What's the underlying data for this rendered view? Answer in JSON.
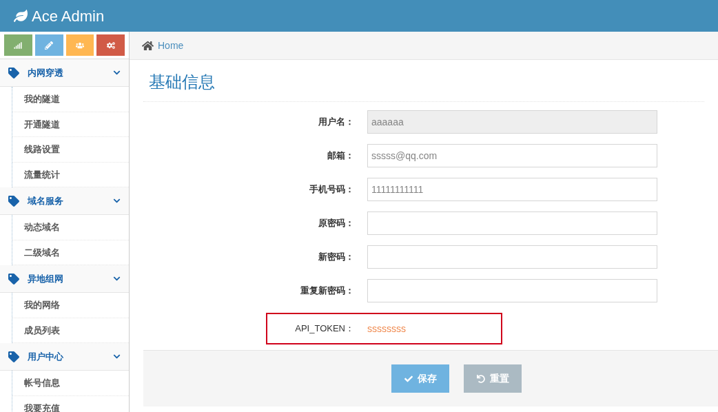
{
  "header": {
    "brand": "Ace Admin"
  },
  "shortcuts": [
    {
      "kind": "chart",
      "color": "#82af6f"
    },
    {
      "kind": "pencil",
      "color": "#6fb3e0"
    },
    {
      "kind": "users",
      "color": "#ffb752"
    },
    {
      "kind": "cogs",
      "color": "#d15b47"
    }
  ],
  "sidebar": {
    "groups": [
      {
        "label": "内网穿透",
        "expanded": true,
        "items": [
          "我的隧道",
          "开通隧道",
          "线路设置",
          "流量统计"
        ]
      },
      {
        "label": "域名服务",
        "expanded": true,
        "items": [
          "动态域名",
          "二级域名"
        ]
      },
      {
        "label": "异地组网",
        "expanded": true,
        "items": [
          "我的网络",
          "成员列表"
        ]
      },
      {
        "label": "用户中心",
        "expanded": true,
        "items": [
          "帐号信息",
          "我要充值"
        ]
      }
    ]
  },
  "breadcrumb": {
    "label": "Home"
  },
  "page_title": "基础信息",
  "form": {
    "fields": [
      {
        "label": "用户名：",
        "value": "aaaaaa",
        "disabled": true
      },
      {
        "label": "邮箱：",
        "value": "sssss@qq.com",
        "disabled": false
      },
      {
        "label": "手机号码：",
        "value": "11111111111",
        "disabled": false
      },
      {
        "label": "原密码：",
        "disabled": false
      },
      {
        "label": "新密码：",
        "disabled": false
      },
      {
        "label": "重复新密码：",
        "disabled": false
      }
    ],
    "token": {
      "label": "API_TOKEN：",
      "value": "ssssssss",
      "highlighted": true
    }
  },
  "buttons": [
    {
      "kind": "save",
      "label": "保存"
    },
    {
      "kind": "reset",
      "label": "重置"
    }
  ]
}
